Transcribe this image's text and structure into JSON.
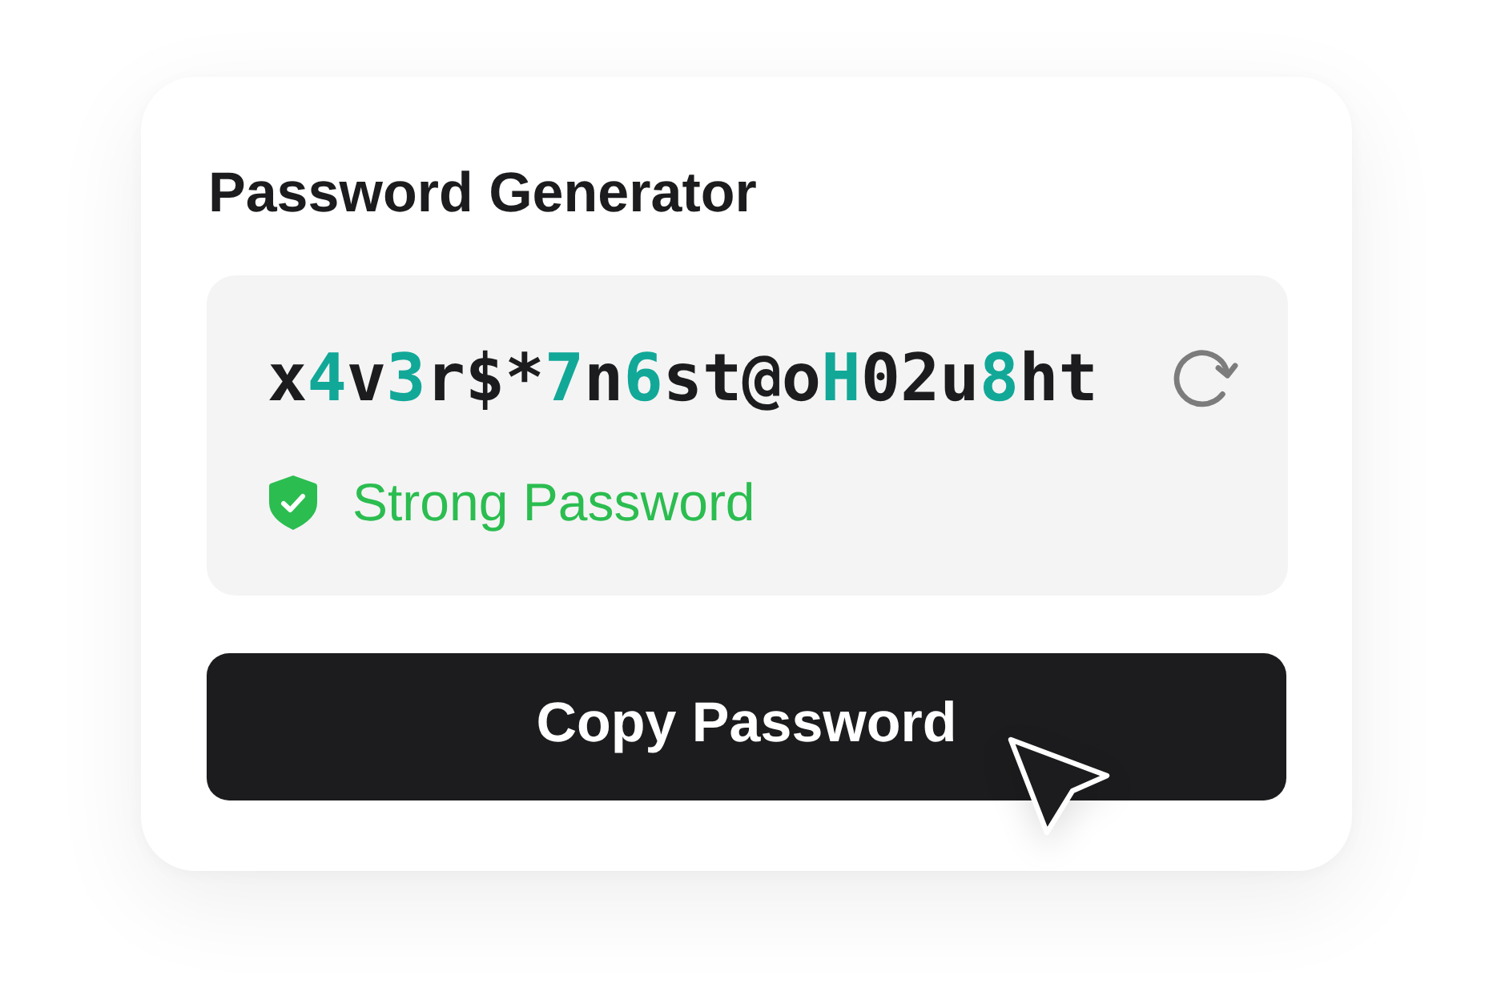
{
  "card": {
    "title": "Password Generator"
  },
  "password": {
    "segments": [
      {
        "text": "x",
        "highlighted": false
      },
      {
        "text": "4",
        "highlighted": true
      },
      {
        "text": "v",
        "highlighted": false
      },
      {
        "text": "3",
        "highlighted": true
      },
      {
        "text": "r$*",
        "highlighted": false
      },
      {
        "text": "7",
        "highlighted": true
      },
      {
        "text": "n",
        "highlighted": false
      },
      {
        "text": "6",
        "highlighted": true
      },
      {
        "text": "st@o",
        "highlighted": false
      },
      {
        "text": "H",
        "highlighted": true
      },
      {
        "text": "02u",
        "highlighted": false
      },
      {
        "text": "8",
        "highlighted": true
      },
      {
        "text": "ht",
        "highlighted": false
      }
    ]
  },
  "strength": {
    "label": "Strong Password",
    "strong": true
  },
  "copy_button": {
    "label": "Copy Password"
  }
}
